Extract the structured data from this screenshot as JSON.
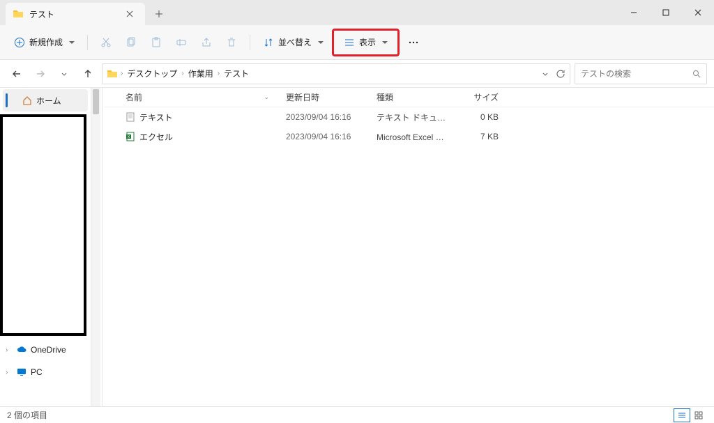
{
  "window": {
    "title": "テスト",
    "controls": {
      "minimize": "–",
      "maximize": "☐",
      "close": "✕"
    }
  },
  "toolbar": {
    "new_label": "新規作成",
    "sort_label": "並べ替え",
    "view_label": "表示"
  },
  "breadcrumb": [
    "デスクトップ",
    "作業用",
    "テスト"
  ],
  "search": {
    "placeholder": "テストの検索"
  },
  "sidebar": {
    "home": "ホーム",
    "onedrive": "OneDrive",
    "pc": "PC"
  },
  "columns": {
    "name": "名前",
    "date": "更新日時",
    "type": "種類",
    "size": "サイズ"
  },
  "files": [
    {
      "icon": "text",
      "name": "テキスト",
      "date": "2023/09/04 16:16",
      "type": "テキスト ドキュメント",
      "size": "0 KB"
    },
    {
      "icon": "excel",
      "name": "エクセル",
      "date": "2023/09/04 16:16",
      "type": "Microsoft Excel ワ...",
      "size": "7 KB"
    }
  ],
  "status": {
    "count": "2 個の項目"
  }
}
